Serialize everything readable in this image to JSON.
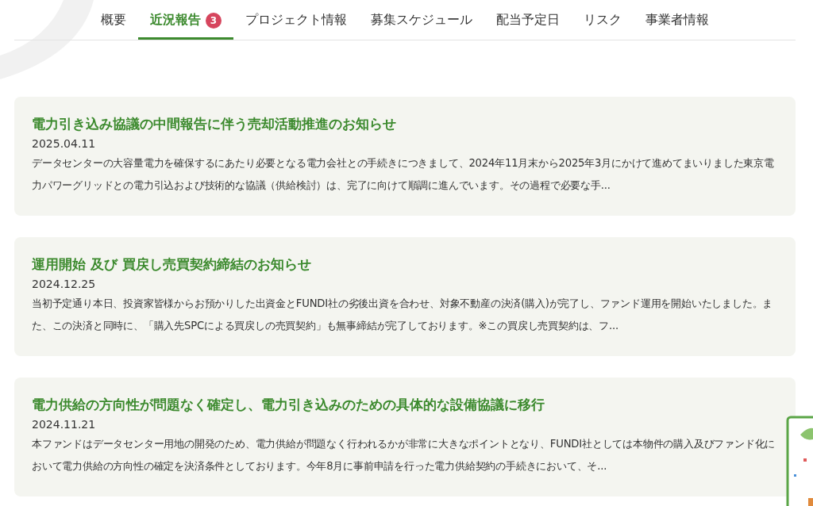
{
  "tabs": [
    {
      "label": "概要",
      "selected": false
    },
    {
      "label": "近況報告",
      "selected": true,
      "badge": "3"
    },
    {
      "label": "プロジェクト情報",
      "selected": false
    },
    {
      "label": "募集スケジュール",
      "selected": false
    },
    {
      "label": "配当予定日",
      "selected": false
    },
    {
      "label": "リスク",
      "selected": false
    },
    {
      "label": "事業者情報",
      "selected": false
    }
  ],
  "news": [
    {
      "title": "電力引き込み協議の中間報告に伴う売却活動推進のお知らせ",
      "date": "2025.04.11",
      "summary": "データセンターの大容量電力を確保するにあたり必要となる電力会社との手続きにつきまして、2024年11月末から2025年3月にかけて進めてまいりました東京電力パワーグリッドとの電力引込および技術的な協議（供給検討）は、完了に向けて順調に進んでいます。その過程で必要な手..."
    },
    {
      "title": "運用開始 及び 買戻し売買契約締結のお知らせ",
      "date": "2024.12.25",
      "summary": "当初予定通り本日、投資家皆様からお預かりした出資金とFUNDI社の劣後出資を合わせ、対象不動産の決済(購入)が完了し、ファンド運用を開始いたしました。また、この決済と同時に、「購入先SPCによる買戻しの売買契約」も無事締結が完了しております。※この買戻し売買契約は、フ..."
    },
    {
      "title": "電力供給の方向性が問題なく確定し、電力引き込みのための具体的な設備協議に移行",
      "date": "2024.11.21",
      "summary": "本ファンドはデータセンター用地の開発のため、電力供給が問題なく行われるかが非常に大きなポイントとなり、FUNDI社としては本物件の購入及びファンド化において電力供給の方向性の確定を決済条件としております。今年8月に事前申請を行った電力供給契約の手続きにおいて、そ..."
    }
  ]
}
